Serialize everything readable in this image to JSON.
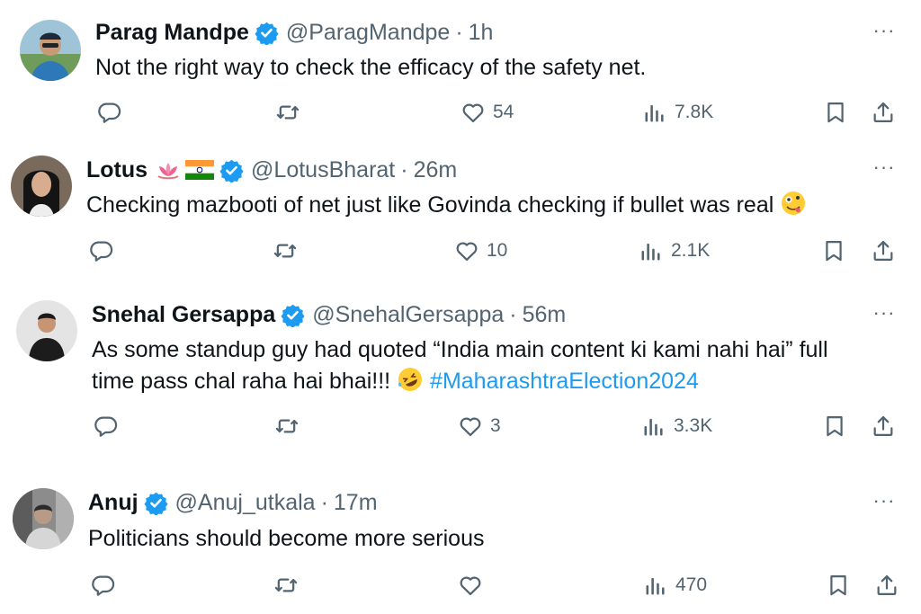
{
  "tweets": [
    {
      "name": "Parag Mandpe",
      "handle": "@ParagMandpe",
      "time": "1h",
      "text": "Not the right way to check the efficacy of the safety net.",
      "likes": "54",
      "views": "7.8K"
    },
    {
      "name": "Lotus",
      "handle": "@LotusBharat",
      "time": "26m",
      "text": "Checking mazbooti of net just like Govinda checking if bullet was real",
      "likes": "10",
      "views": "2.1K"
    },
    {
      "name": "Snehal Gersappa",
      "handle": "@SnehalGersappa",
      "time": "56m",
      "text_line1": "As some standup guy had quoted “India main content ki kami nahi hai” full",
      "text_line2": "time pass chal raha hai bhai!!!",
      "hashtag": "#MaharashtraElection2024",
      "likes": "3",
      "views": "3.3K"
    },
    {
      "name": "Anuj",
      "handle": "@Anuj_utkala",
      "time": "17m",
      "text": "Politicians should become more serious",
      "likes": "",
      "views": "470"
    }
  ],
  "separator": "·",
  "more_label": "···",
  "colors": {
    "verified": "#1d9bf0",
    "secondary": "#536471",
    "hashtag": "#1d9bf0"
  },
  "icons": [
    "reply-icon",
    "retweet-icon",
    "like-icon",
    "views-icon",
    "bookmark-icon",
    "share-icon",
    "verified-badge-icon",
    "more-icon"
  ]
}
